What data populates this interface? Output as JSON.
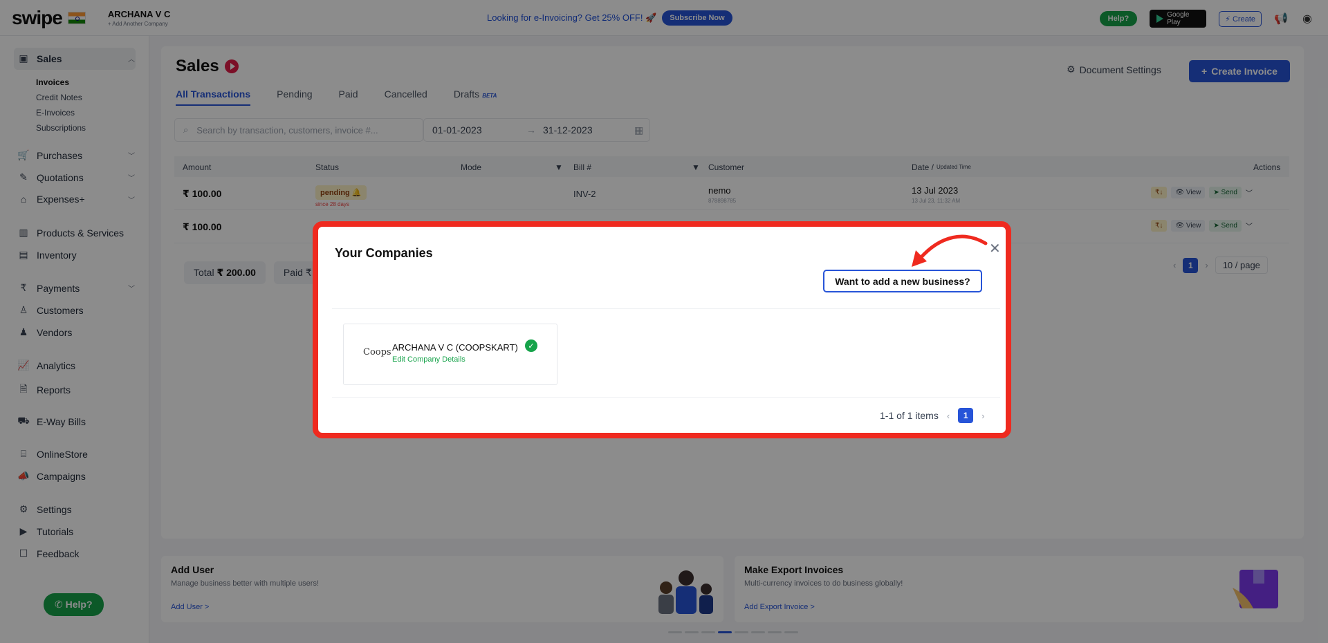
{
  "topbar": {
    "logo": "swipe",
    "company_name": "ARCHANA V C",
    "company_sub": "+ Add Another Company",
    "promo_text": "Looking for e-Invoicing? Get 25% OFF! 🚀",
    "subscribe_label": "Subscribe Now",
    "help_label": "Help?",
    "google_play_top": "GET IT ON",
    "google_play_label": "Google Play",
    "create_label": "⚡ Create"
  },
  "sidebar": {
    "sales_label": "Sales",
    "sub_items": [
      "Invoices",
      "Credit Notes",
      "E-Invoices",
      "Subscriptions"
    ],
    "items": [
      {
        "label": "Purchases",
        "icon": "cart-icon"
      },
      {
        "label": "Quotations",
        "icon": "pen-icon"
      },
      {
        "label": "Expenses+",
        "icon": "tag-icon"
      },
      {
        "label": "Products & Services",
        "icon": "barcode-icon"
      },
      {
        "label": "Inventory",
        "icon": "warehouse-icon"
      },
      {
        "label": "Payments",
        "icon": "rupee-icon"
      },
      {
        "label": "Customers",
        "icon": "user-icon"
      },
      {
        "label": "Vendors",
        "icon": "users-icon"
      },
      {
        "label": "Analytics",
        "icon": "chart-icon"
      },
      {
        "label": "Reports",
        "icon": "report-icon"
      },
      {
        "label": "E-Way Bills",
        "icon": "truck-icon"
      },
      {
        "label": "OnlineStore",
        "icon": "store-icon"
      },
      {
        "label": "Campaigns",
        "icon": "megaphone-icon"
      },
      {
        "label": "Settings",
        "icon": "gear-icon"
      },
      {
        "label": "Tutorials",
        "icon": "youtube-icon"
      },
      {
        "label": "Feedback",
        "icon": "chat-icon"
      }
    ],
    "help_label": "Help?"
  },
  "main": {
    "title": "Sales",
    "doc_settings_label": "Document Settings",
    "create_invoice_label": "Create Invoice",
    "tabs": [
      "All Transactions",
      "Pending",
      "Paid",
      "Cancelled",
      "Drafts"
    ],
    "beta_label": "BETA",
    "search_placeholder": "Search by transaction, customers, invoice #...",
    "date_from": "01-01-2023",
    "date_to": "31-12-2023",
    "table": {
      "headers": [
        "Amount",
        "Status",
        "Mode",
        "Bill #",
        "Customer",
        "Date /",
        "Updated Time",
        "Actions"
      ],
      "rows": [
        {
          "amount": "₹ 100.00",
          "status": "pending",
          "since": "since 28 days",
          "bill": "INV-2",
          "customer": "nemo",
          "phone": "878898785",
          "date": "13 Jul 2023",
          "time": "13 Jul 23, 11:32 AM"
        },
        {
          "amount": "₹ 100.00"
        }
      ],
      "actions": {
        "pay": "₹↓",
        "view": "View",
        "send": "Send"
      }
    },
    "total_label": "Total",
    "total_value": "₹ 200.00",
    "paid_label": "Paid ₹",
    "pager_page": "1",
    "per_page": "10 / page"
  },
  "promos": {
    "add_user": {
      "title": "Add User",
      "subtitle": "Manage business better with multiple users!",
      "link": "Add User >"
    },
    "export": {
      "title": "Make Export Invoices",
      "subtitle": "Multi-currency invoices to do business globally!",
      "link": "Add Export Invoice >"
    }
  },
  "modal": {
    "title": "Your Companies",
    "add_business_label": "Want to add a new business?",
    "company": {
      "logo_text": "Coops",
      "name": "ARCHANA V C (COOPSKART)",
      "edit_label": "Edit Company Details"
    },
    "pager_summary": "1-1 of 1 items",
    "pager_page": "1"
  },
  "colors": {
    "accent": "#2754d8",
    "highlight": "#ef2a1f",
    "success": "#16a34a"
  }
}
